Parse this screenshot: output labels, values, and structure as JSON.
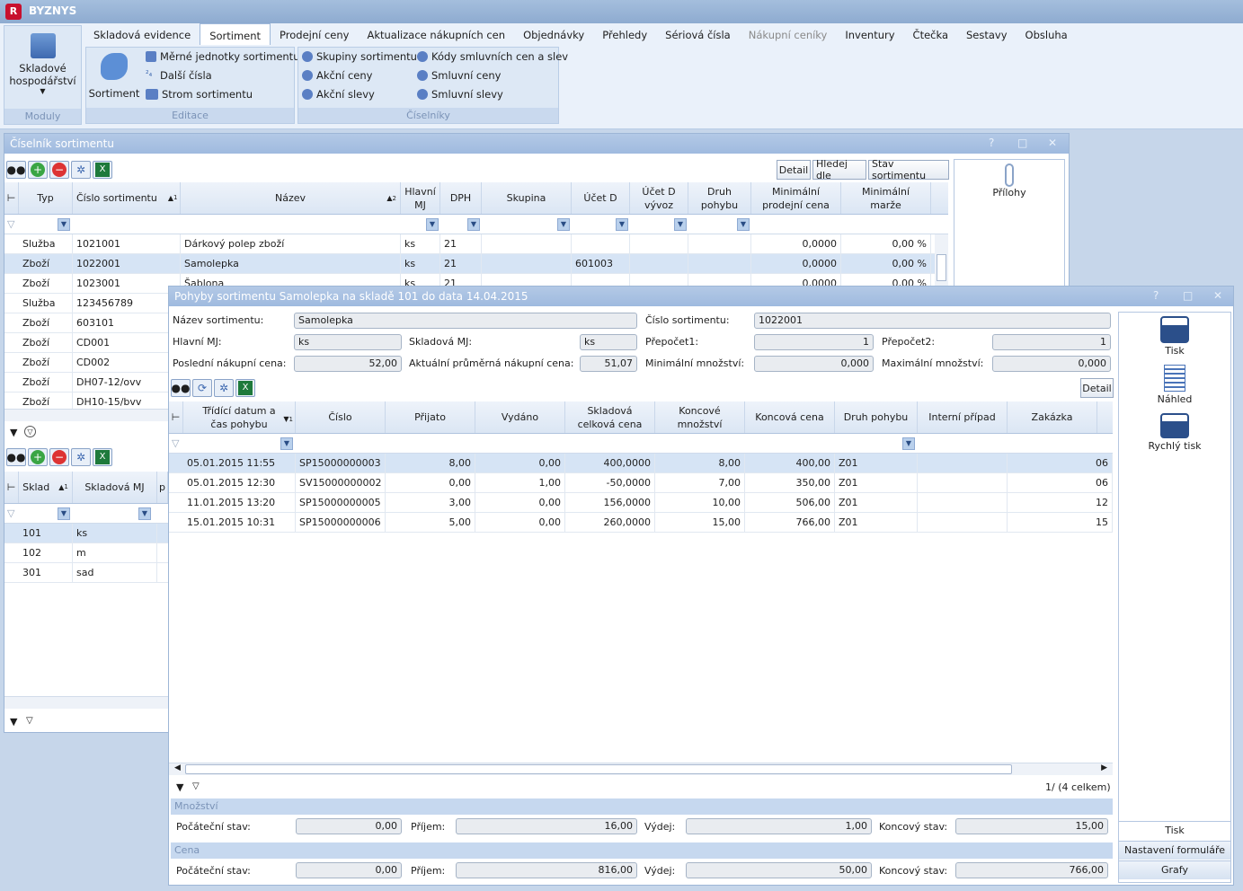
{
  "app": {
    "title": "BYZNYS",
    "logo": "R"
  },
  "ribbon": {
    "module_button": {
      "line1": "Skladové",
      "line2": "hospodářství",
      "group": "Moduly"
    },
    "tabs": [
      {
        "label": "Skladová evidence"
      },
      {
        "label": "Sortiment"
      },
      {
        "label": "Prodejní ceny"
      },
      {
        "label": "Aktualizace nákupních cen"
      },
      {
        "label": "Objednávky"
      },
      {
        "label": "Přehledy"
      },
      {
        "label": "Sériová čísla"
      },
      {
        "label": "Nákupní ceníky"
      },
      {
        "label": "Inventury"
      },
      {
        "label": "Čtečka"
      },
      {
        "label": "Sestavy"
      },
      {
        "label": "Obsluha"
      }
    ],
    "active_tab": "Sortiment",
    "edit_group": {
      "label": "Editace",
      "big": "Sortiment",
      "items": [
        "Měrné jednotky sortimentu",
        "Další čísla",
        "Strom sortimentu"
      ]
    },
    "codes_group": {
      "label": "Číselníky",
      "col1": [
        "Skupiny sortimentu",
        "Akční ceny",
        "Akční slevy"
      ],
      "col2": [
        "Kódy smluvních cen a slev",
        "Smluvní ceny",
        "Smluvní slevy"
      ]
    }
  },
  "catalog": {
    "title": "Číselník sortimentu",
    "controls": [
      "?",
      "□",
      "✕"
    ],
    "buttons": {
      "detail": "Detail",
      "search": "Hledej dle",
      "status": "Stav sortimentu"
    },
    "attachments": "Přílohy",
    "columns": {
      "typ": "Typ",
      "cislo": "Číslo sortimentu",
      "nazev": "Název",
      "mj1": "Hlavní",
      "mj2": "MJ",
      "dph": "DPH",
      "skupina": "Skupina",
      "ucet": "Účet D",
      "ucetv1": "Účet D",
      "ucetv2": "vývoz",
      "druh1": "Druh",
      "druh2": "pohybu",
      "min1": "Minimální",
      "min2": "prodejní cena",
      "marze1": "Minimální",
      "marze2": "marže",
      "sort1": "1",
      "sort2": "2"
    },
    "rows": [
      {
        "typ": "Služba",
        "cislo": "1021001",
        "nazev": "Dárkový polep zboží",
        "mj": "ks",
        "dph": "21",
        "ucet": "",
        "cena": "0,0000",
        "marze": "0,00 %"
      },
      {
        "typ": "Zboží",
        "cislo": "1022001",
        "nazev": "Samolepka",
        "mj": "ks",
        "dph": "21",
        "ucet": "601003",
        "cena": "0,0000",
        "marze": "0,00 %"
      },
      {
        "typ": "Zboží",
        "cislo": "1023001",
        "nazev": "Šablona",
        "mj": "ks",
        "dph": "21",
        "ucet": "",
        "cena": "0,0000",
        "marze": "0,00 %"
      },
      {
        "typ": "Služba",
        "cislo": "123456789"
      },
      {
        "typ": "Zboží",
        "cislo": "603101"
      },
      {
        "typ": "Zboží",
        "cislo": "CD001"
      },
      {
        "typ": "Zboží",
        "cislo": "CD002"
      },
      {
        "typ": "Zboží",
        "cislo": "DH07-12/ovv"
      },
      {
        "typ": "Zboží",
        "cislo": "DH10-15/bvv"
      }
    ],
    "stock": {
      "col_sklad": "Sklad",
      "col_mj": "Skladová MJ",
      "col_p": "p",
      "sort": "1",
      "rows": [
        {
          "sklad": "101",
          "mj": "ks"
        },
        {
          "sklad": "102",
          "mj": "m"
        },
        {
          "sklad": "301",
          "mj": "sad"
        }
      ]
    }
  },
  "movements": {
    "title": "Pohyby sortimentu Samolepka na skladě 101  do data 14.04.2015",
    "controls": [
      "?",
      "□",
      "✕"
    ],
    "fields": {
      "nazev_label": "Název sortimentu:",
      "nazev": "Samolepka",
      "cislo_label": "Číslo sortimentu:",
      "cislo": "1022001",
      "hmj_label": "Hlavní MJ:",
      "hmj": "ks",
      "smj_label": "Skladová MJ:",
      "smj": "ks",
      "p1_label": "Přepočet1:",
      "p1": "1",
      "p2_label": "Přepočet2:",
      "p2": "1",
      "pnc_label": "Poslední nákupní cena:",
      "pnc": "52,00",
      "apnc_label": "Aktuální průměrná nákupní cena:",
      "apnc": "51,07",
      "minm_label": "Minimální množství:",
      "minm": "0,000",
      "maxm_label": "Maximální množství:",
      "maxm": "0,000"
    },
    "detail_button": "Detail",
    "columns": {
      "datum1": "Třídící datum a",
      "datum2": "čas pohybu",
      "sort": "1",
      "cislo": "Číslo",
      "prijato": "Přijato",
      "vydano": "Vydáno",
      "skl1": "Skladová",
      "skl2": "celková cena",
      "konc1": "Koncové",
      "konc2": "množství",
      "kcena": "Koncová cena",
      "druh": "Druh pohybu",
      "interni": "Interní případ",
      "zakazka": "Zakázka"
    },
    "rows": [
      {
        "datum": "05.01.2015 11:55",
        "cislo": "SP15000000003",
        "prijato": "8,00",
        "vydano": "0,00",
        "skl": "400,0000",
        "konc": "8,00",
        "kcena": "400,00",
        "druh": "Z01",
        "zak": "06"
      },
      {
        "datum": "05.01.2015 12:30",
        "cislo": "SV15000000002",
        "prijato": "0,00",
        "vydano": "1,00",
        "skl": "-50,0000",
        "konc": "7,00",
        "kcena": "350,00",
        "druh": "Z01",
        "zak": "06"
      },
      {
        "datum": "11.01.2015 13:20",
        "cislo": "SP15000000005",
        "prijato": "3,00",
        "vydano": "0,00",
        "skl": "156,0000",
        "konc": "10,00",
        "kcena": "506,00",
        "druh": "Z01",
        "zak": "12"
      },
      {
        "datum": "15.01.2015 10:31",
        "cislo": "SP15000000006",
        "prijato": "5,00",
        "vydano": "0,00",
        "skl": "260,0000",
        "konc": "15,00",
        "kcena": "766,00",
        "druh": "Z01",
        "zak": "15"
      }
    ],
    "pager": "1/ (4 celkem)",
    "qty": {
      "title": "Množství",
      "poc_label": "Počáteční stav:",
      "poc": "0,00",
      "prij_label": "Příjem:",
      "prij": "16,00",
      "vyd_label": "Výdej:",
      "vyd": "1,00",
      "konc_label": "Koncový stav:",
      "konc": "15,00"
    },
    "price": {
      "title": "Cena",
      "poc_label": "Počáteční stav:",
      "poc": "0,00",
      "prij_label": "Příjem:",
      "prij": "816,00",
      "vyd_label": "Výdej:",
      "vyd": "50,00",
      "konc_label": "Koncový stav:",
      "konc": "766,00"
    },
    "side": {
      "tisk": "Tisk",
      "nahled": "Náhled",
      "rychly": "Rychlý tisk",
      "bottom": [
        "Tisk",
        "Nastavení formuláře",
        "Grafy"
      ]
    }
  }
}
